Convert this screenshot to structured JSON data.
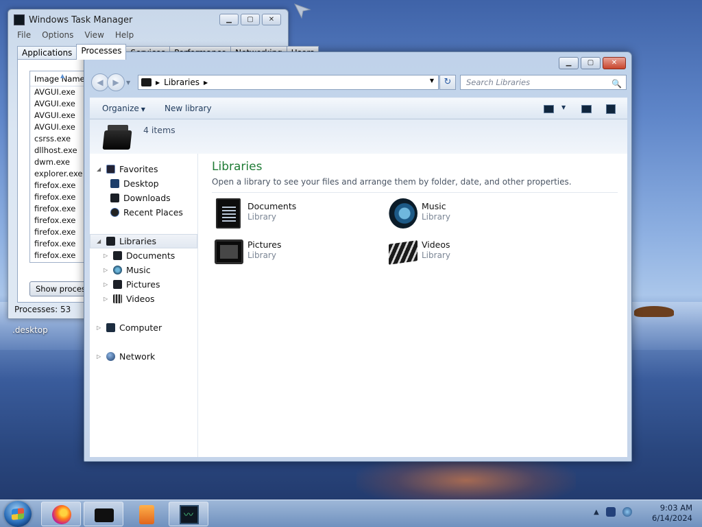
{
  "desktop": {
    "label": ".desktop"
  },
  "task_manager": {
    "title": "Windows Task Manager",
    "minimize": "▁",
    "maximize": "▢",
    "close": "✕",
    "menu": [
      "File",
      "Options",
      "View",
      "Help"
    ],
    "tabs": [
      "Applications",
      "Processes",
      "Services",
      "Performance",
      "Networking",
      "Users"
    ],
    "active_tab": "Processes",
    "column_header": "Image Name",
    "processes": [
      "AVGUI.exe",
      "AVGUI.exe",
      "AVGUI.exe",
      "AVGUI.exe",
      "csrss.exe",
      "dllhost.exe",
      "dwm.exe",
      "explorer.exe",
      "firefox.exe",
      "firefox.exe",
      "firefox.exe",
      "firefox.exe",
      "firefox.exe",
      "firefox.exe",
      "firefox.exe"
    ],
    "show_processes_button": "Show processes from all users",
    "status": "Processes: 53"
  },
  "explorer": {
    "minimize": "▁",
    "maximize": "▢",
    "close": "✕",
    "back": "◀",
    "forward": "▶",
    "address": {
      "segment": "Libraries"
    },
    "refresh": "↻",
    "search": {
      "placeholder": "Search Libraries",
      "icon": "🔍"
    },
    "toolbar": {
      "organize": "Organize",
      "new_library": "New library"
    },
    "details": {
      "items_count": "4 items"
    },
    "nav_pane": {
      "favorites": "Favorites",
      "desktop": "Desktop",
      "downloads": "Downloads",
      "recent_places": "Recent Places",
      "libraries": "Libraries",
      "documents": "Documents",
      "music": "Music",
      "pictures": "Pictures",
      "videos": "Videos",
      "computer": "Computer",
      "network": "Network"
    },
    "main": {
      "title": "Libraries",
      "subtitle": "Open a library to see your files and arrange them by folder, date, and other properties.",
      "libraries": [
        {
          "name": "Documents",
          "type": "Library",
          "icon": "documents-library-icon"
        },
        {
          "name": "Music",
          "type": "Library",
          "icon": "music-library-icon"
        },
        {
          "name": "Pictures",
          "type": "Library",
          "icon": "pictures-library-icon"
        },
        {
          "name": "Videos",
          "type": "Library",
          "icon": "videos-library-icon"
        }
      ]
    }
  },
  "taskbar": {
    "time": "9:03 AM",
    "date": "6/14/2024",
    "tray_arrow": "▲"
  },
  "colors": {
    "library_title": "#1e7b35",
    "close_button": "#c8452d"
  }
}
